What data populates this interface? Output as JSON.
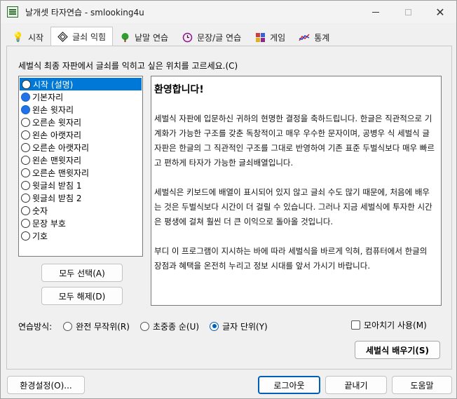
{
  "window": {
    "title": "날개셋 타자연습 - smlooking4u",
    "icon": "app-keyboard-icon"
  },
  "tabs": [
    {
      "label": "시작",
      "icon": "lightbulb-icon",
      "active": false
    },
    {
      "label": "글쇠 익힘",
      "icon": "diamond-key-icon",
      "active": true
    },
    {
      "label": "낱말 연습",
      "icon": "tree-icon",
      "active": false
    },
    {
      "label": "문장/글 연습",
      "icon": "clock-icon",
      "active": false
    },
    {
      "label": "게임",
      "icon": "puzzle-icon",
      "active": false
    },
    {
      "label": "통계",
      "icon": "line-chart-icon",
      "active": false
    }
  ],
  "instruction": "세벌식 최종 자판에서 글쇠를 익히고 싶은 위치를 고르세요.(C)",
  "positions": [
    {
      "label": "시작 (설명)",
      "checked": false,
      "selected": true
    },
    {
      "label": "기본자리",
      "checked": true,
      "selected": false
    },
    {
      "label": "왼손 윗자리",
      "checked": true,
      "selected": false
    },
    {
      "label": "오른손 윗자리",
      "checked": false,
      "selected": false
    },
    {
      "label": "왼손 아랫자리",
      "checked": false,
      "selected": false
    },
    {
      "label": "오른손 아랫자리",
      "checked": false,
      "selected": false
    },
    {
      "label": "왼손 맨윗자리",
      "checked": false,
      "selected": false
    },
    {
      "label": "오른손 맨윗자리",
      "checked": false,
      "selected": false
    },
    {
      "label": "윗글쇠 받침 1",
      "checked": false,
      "selected": false
    },
    {
      "label": "윗글쇠 받침 2",
      "checked": false,
      "selected": false
    },
    {
      "label": "숫자",
      "checked": false,
      "selected": false
    },
    {
      "label": "문장 부호",
      "checked": false,
      "selected": false
    },
    {
      "label": "기호",
      "checked": false,
      "selected": false
    }
  ],
  "buttons": {
    "select_all": "모두 선택(A)",
    "deselect_all": "모두 해제(D)",
    "learn": "세벌식 배우기(S)",
    "settings": "환경설정(O)...",
    "logout": "로그아웃",
    "exit": "끝내기",
    "help": "도움말"
  },
  "info": {
    "title": "환영합니다!",
    "paragraphs": [
      "세벌식 자판에 입문하신 귀하의 현명한 결정을 축하드립니다. 한글은 직관적으로 기계화가 가능한 구조를 갖춘 독창적이고 매우 우수한 문자이며, 공병우 식 세벌식 글자판은 한글의 그 직관적인 구조를 그대로 반영하여 기존 표준 두벌식보다 매우 빠르고 편하게 타자가 가능한 글쇠배열입니다.",
      "세벌식은 키보드에 배열이 표시되어 있지 않고 글쇠 수도 많기 때문에, 처음에 배우는 것은 두벌식보다 시간이 더 걸릴 수 있습니다. 그러나 지금 세벌식에 투자한 시간은 평생에 걸쳐 훨씬 더 큰 이익으로 돌아올 것입니다.",
      "부디 이 프로그램이 지시하는 바에 따라 세벌식을 바르게 익혀, 컴퓨터에서 한글의 장점과 혜택을 온전히 누리고 정보 시대를 앞서 가시기 바랍니다."
    ]
  },
  "practice_mode": {
    "label": "연습방식:",
    "options": [
      {
        "label": "완전 무작위(R)",
        "selected": false
      },
      {
        "label": "초중종 순(U)",
        "selected": false
      },
      {
        "label": "글자 단위(Y)",
        "selected": true
      }
    ]
  },
  "moachigi": {
    "label": "모아치기 사용(M)",
    "checked": false
  },
  "colors": {
    "accent": "#0078d7",
    "radio_on": "#1e73e8",
    "focus_border": "#005fb8"
  }
}
